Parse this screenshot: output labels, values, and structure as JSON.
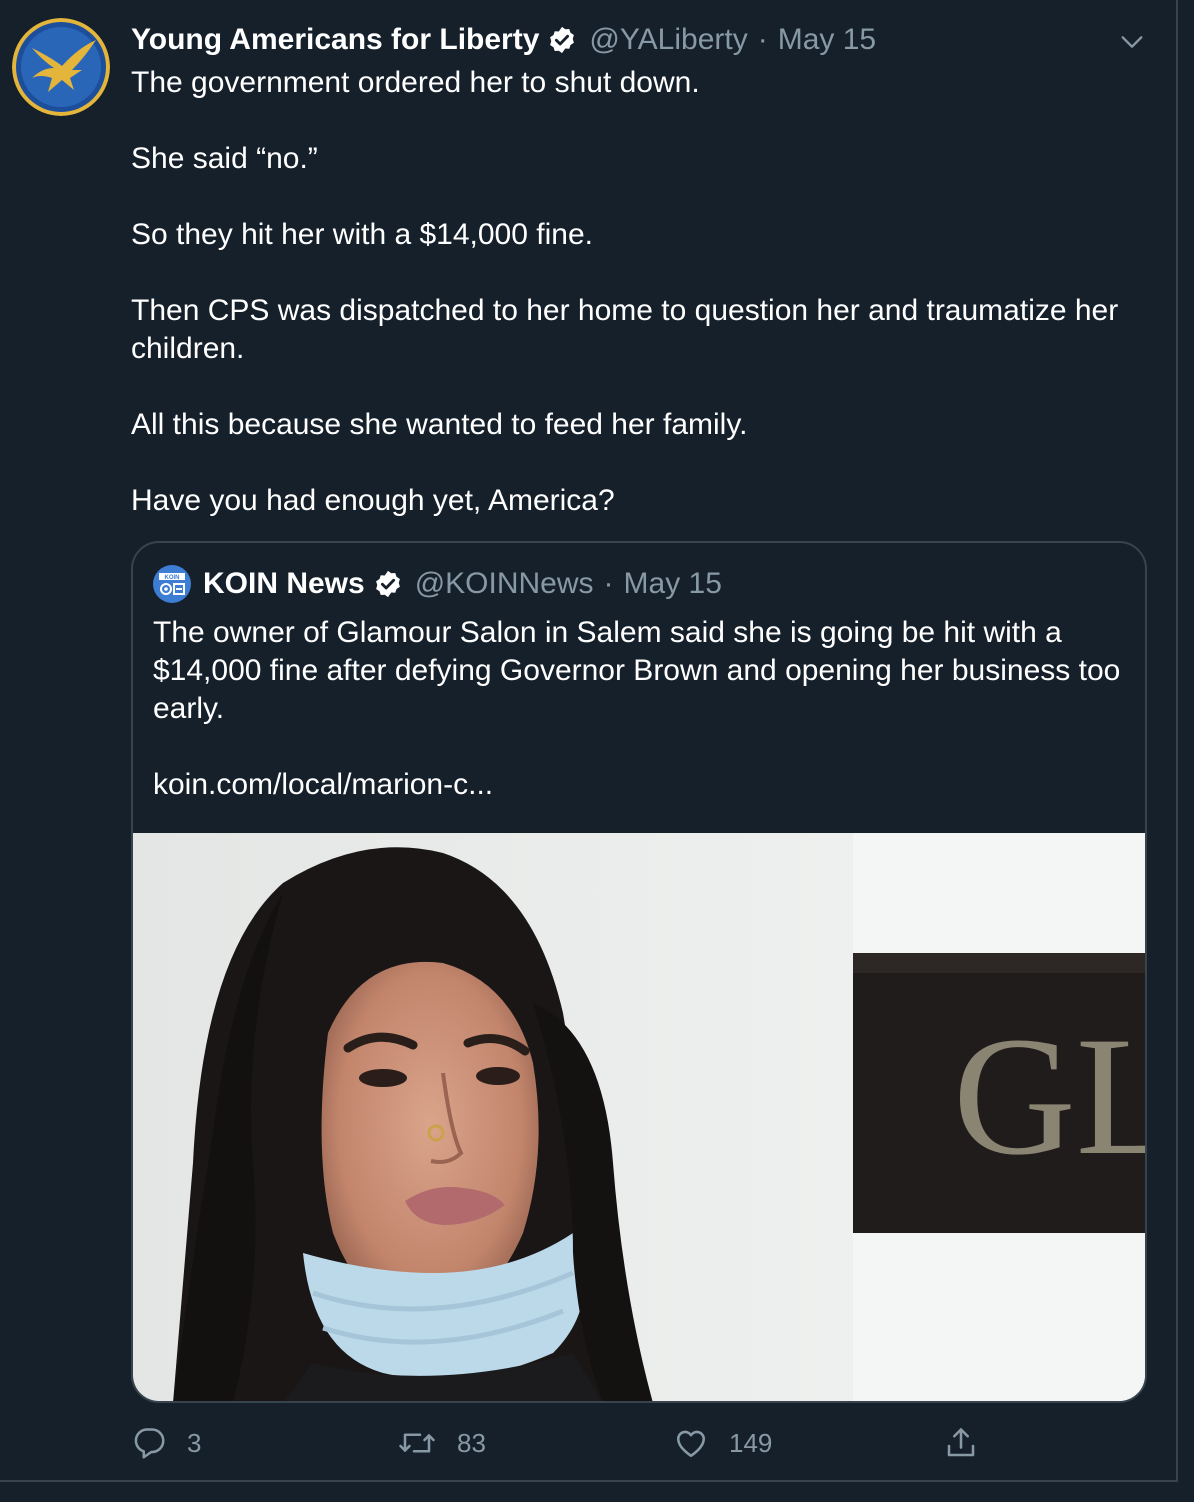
{
  "tweet": {
    "author_name": "Young Americans for Liberty",
    "handle": "@YALiberty",
    "separator": "·",
    "date": "May 15",
    "paragraphs": [
      "The government ordered her to shut down.",
      "She said “no.”",
      "So they hit her with a $14,000 fine.",
      "Then CPS was dispatched to her home to question her and traumatize her children.",
      "All this because she wanted to feed her family.",
      "Have you had enough yet, America?"
    ]
  },
  "quoted_tweet": {
    "author_name": "KOIN News",
    "handle": "@KOINNews",
    "separator": "·",
    "date": "May 15",
    "logo_text": "KOIN",
    "paragraphs": [
      "The owner of Glamour Salon in Salem said she is going be hit with a $14,000 fine after defying Governor Brown and opening her business too early.",
      "koin.com/local/marion-c..."
    ],
    "image_sign_text": "GL"
  },
  "actions": {
    "reply_count": "3",
    "retweet_count": "83",
    "like_count": "149"
  },
  "colors": {
    "background": "#15202b",
    "border": "#38444d",
    "secondary_text": "#8899a6",
    "verified": "#ffffff",
    "avatar_blue": "#1c4e9c",
    "avatar_ring": "#e3b53a"
  }
}
